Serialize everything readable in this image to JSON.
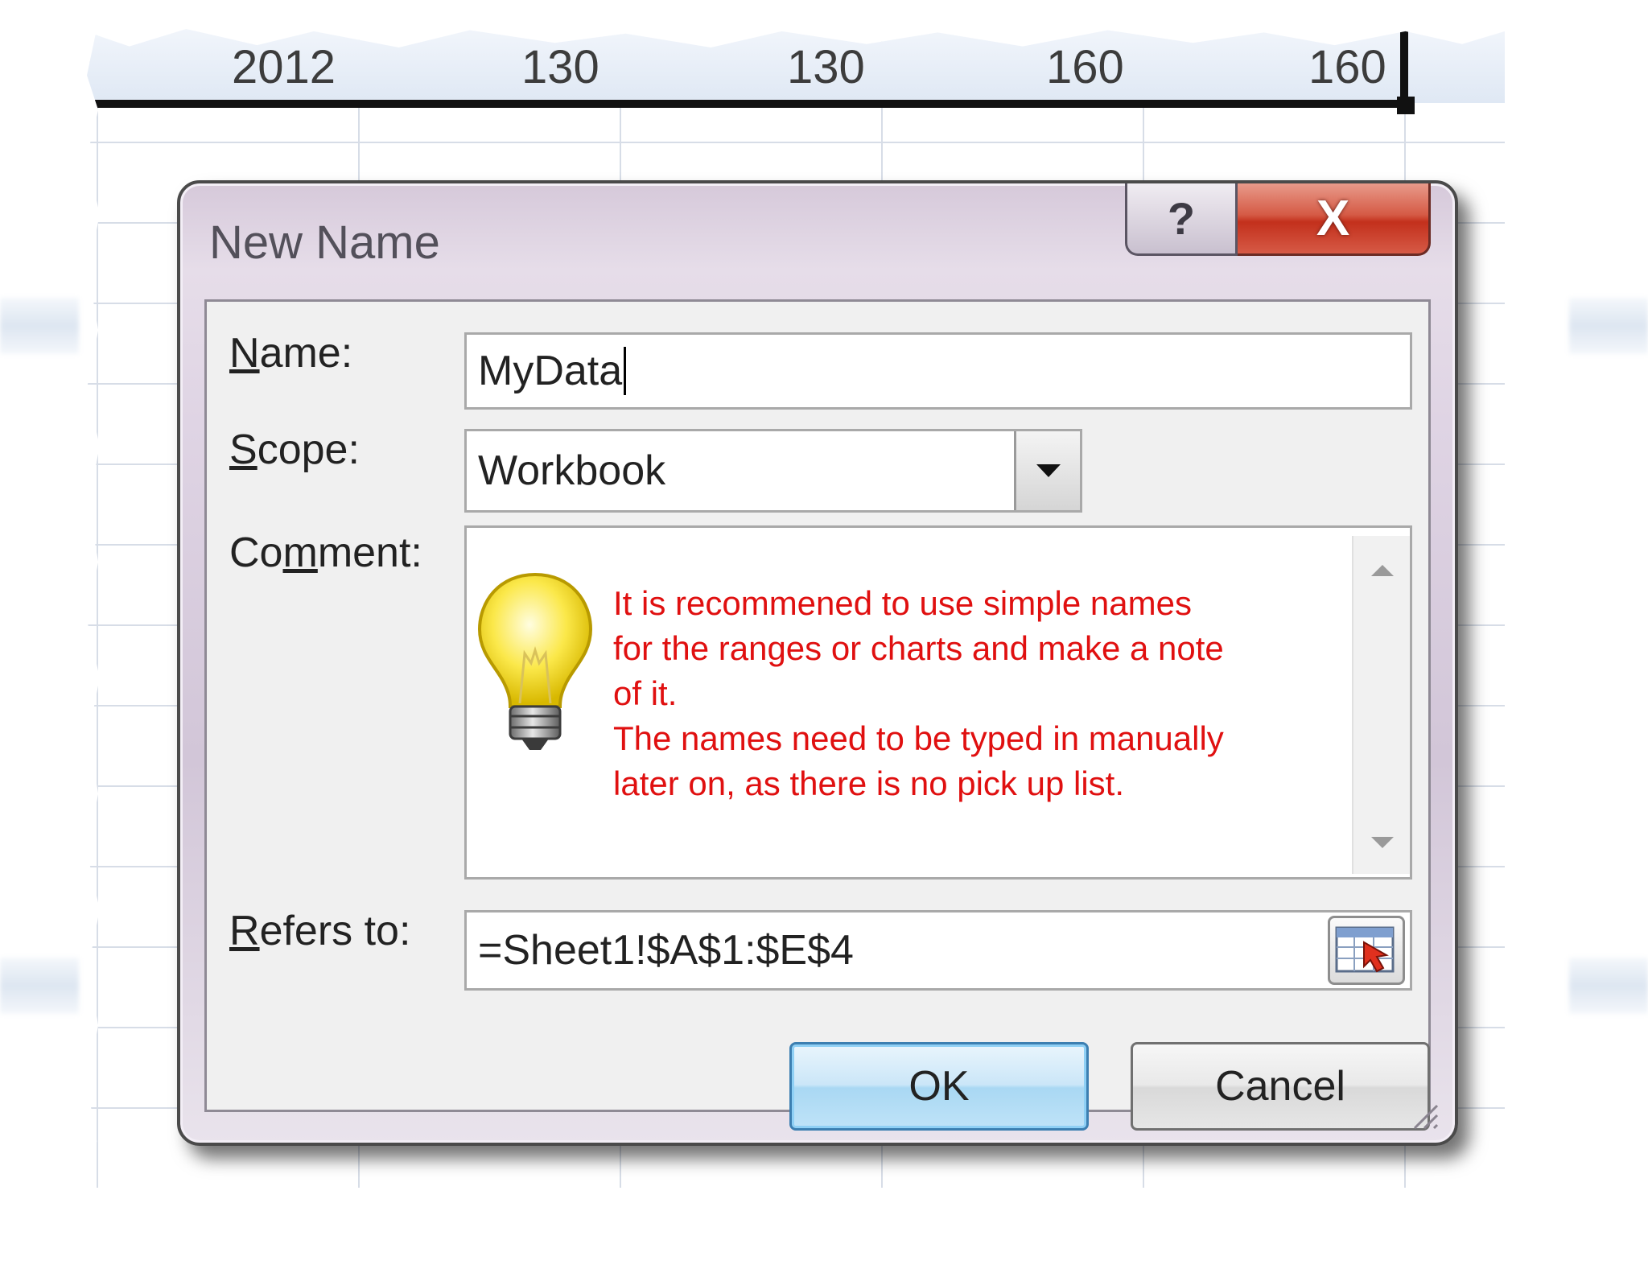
{
  "sheet": {
    "row_values": [
      "2012",
      "130",
      "130",
      "160",
      "160"
    ]
  },
  "dialog": {
    "title": "New Name",
    "help_label": "?",
    "close_label": "X",
    "name_label_first": "N",
    "name_label_rest": "ame:",
    "name_value": "MyData",
    "scope_label_first": "S",
    "scope_label_rest": "cope:",
    "scope_value": "Workbook",
    "comment_label_pre": "Co",
    "comment_label_first": "m",
    "comment_label_rest": "ment:",
    "comment_lines": [
      "It is recommened to use simple names",
      "for the ranges or charts and make a note",
      "of it.",
      "The names need to be typed in manually",
      "later on, as there is no pick up list."
    ],
    "refers_label_first": "R",
    "refers_label_rest": "efers to:",
    "refers_value": "=Sheet1!$A$1:$E$4",
    "ok_label": "OK",
    "cancel_label": "Cancel"
  },
  "colors": {
    "comment_text": "#e01010",
    "close_button": "#c3301c",
    "ok_border": "#3c7fb1"
  },
  "icons": [
    "help-icon",
    "close-icon",
    "dropdown-arrow-icon",
    "lightbulb-icon",
    "scroll-up-icon",
    "scroll-down-icon",
    "range-select-icon",
    "resize-grip-icon"
  ]
}
